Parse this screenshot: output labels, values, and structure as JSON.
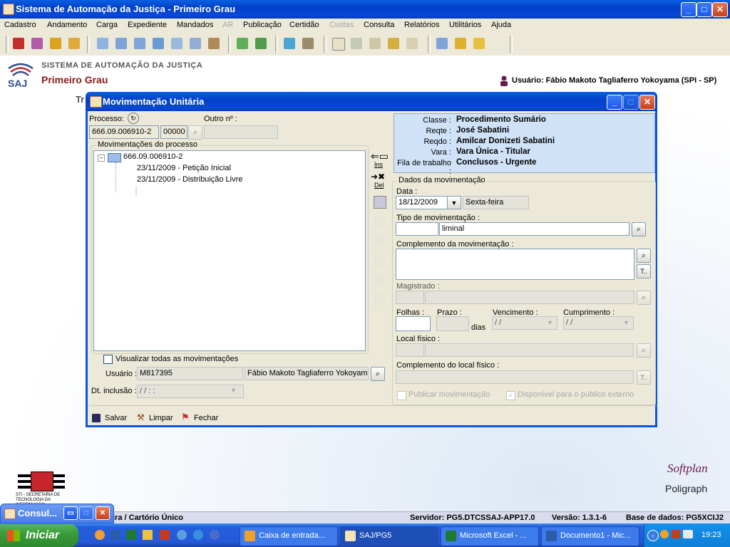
{
  "app": {
    "title": "Sistema de Automação da Justiça - Primeiro Grau",
    "window_buttons": [
      "_",
      "□",
      "✕"
    ]
  },
  "menu": [
    "Cadastro",
    "Andamento",
    "Carga",
    "Expediente",
    "Mandados",
    "AR",
    "Publicação",
    "Certidão",
    "Custas",
    "Consulta",
    "Relatórios",
    "Utilitários",
    "Ajuda"
  ],
  "header": {
    "logo_text": "SAJ",
    "system_name": "SISTEMA DE AUTOMAÇÃO DA JUSTIÇA",
    "subtitle": "Primeiro Grau",
    "user_label": "Usuário: Fábio Makoto Tagliaferro Yokoyama (SPI - SP)",
    "partial_text": "Tr"
  },
  "dialog": {
    "title": "Movimentação Unitária",
    "processo_label": "Processo:",
    "processo_number": "666.09.006910-2",
    "processo_suffix": "00000",
    "outro_label": "Outro nº :",
    "outro_value": "",
    "movimentacoes_caption": "Movimentações do processo",
    "tree": {
      "root": "666.09.006910-2",
      "items": [
        "23/11/2009 - Petição Inicial",
        "23/11/2009 - Distribuição Livre"
      ]
    },
    "side_ins": "Ins",
    "side_del": "Del",
    "visualizar_label": "Visualizar todas as movimentações",
    "usuario_label": "Usuário :",
    "usuario_code": "M817395",
    "usuario_name": "Fábio Makoto Tagliaferro Yokoyama",
    "dt_inclusao_label": "Dt. inclusão :",
    "dt_inclusao_value": " /  /      :  :",
    "info": {
      "classe_k": "Classe :",
      "classe_v": "Procedimento Sumário",
      "reqte_k": "Reqte :",
      "reqte_v": "José Sabatini",
      "reqdo_k": "Reqdo :",
      "reqdo_v": "Amilcar Donizeti Sabatini",
      "vara_k": "Vara :",
      "vara_v": "Vara Única - Titular",
      "fila_k": "Fila de trabalho :",
      "fila_v": "Conclusos - Urgente"
    },
    "dados_caption": "Dados da movimentação",
    "data_label": "Data :",
    "data_value": "18/12/2009",
    "weekday": "Sexta-feira",
    "tipo_label": "Tipo de movimentação :",
    "tipo_code": "",
    "tipo_value": "liminal",
    "complemento_label": "Complemento da movimentação :",
    "complemento_value": "",
    "magistrado_label": "Magistrado :",
    "folhas_label": "Folhas :",
    "prazo_label": "Prazo :",
    "dias_label": "dias",
    "vencimento_label": "Vencimento :",
    "vencimento_value": " /  /",
    "cumprimento_label": "Cumprimento :",
    "cumprimento_value": " /  /",
    "local_label": "Local físico :",
    "complemento_local_label": "Complemento do local físico :",
    "publicar_label": "Publicar movimentação",
    "disponivel_label": "Disponível para o público externo",
    "btn_salvar": "Salvar",
    "btn_limpar": "Limpar",
    "btn_fechar": "Fechar"
  },
  "bottom_logos": {
    "sti_text": "STI - SECRETARIA DE TECNOLOGIA DA INFORMAÇÃO",
    "softplan": "Softplan",
    "poligraph": "Poligraph"
  },
  "status": {
    "left": "ira / Cartório Único",
    "servidor": "Servidor: PG5.DTCSSAJ-APP17.0",
    "versao": "Versão: 1.3.1-6",
    "base": "Base de dados: PG5XCIJ2"
  },
  "mini_window": {
    "title": "Consul..."
  },
  "taskbar": {
    "start": "Iniciar",
    "tasks": [
      "Caixa de entrada...",
      "SAJ/PG5",
      "Microsoft Excel - ...",
      "Documento1 - Mic..."
    ],
    "clock": "19:23"
  }
}
